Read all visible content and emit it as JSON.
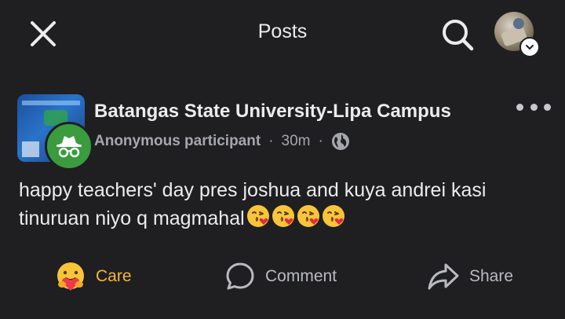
{
  "header": {
    "title": "Posts",
    "close_icon": "close-icon",
    "search_icon": "search-icon",
    "account_menu_icon": "chevron-down-icon"
  },
  "post": {
    "group_name": "Batangas State University-Lipa Campus",
    "author": "Anonymous participant",
    "time": "30m",
    "separator": "·",
    "audience_icon": "globe-icon",
    "more_icon": "more-horizontal-icon",
    "text": "happy teachers' day pres joshua and kuya andrei kasi tinuruan niyo q magmahal",
    "emoji_count": 4,
    "emoji_icon": "face-blowing-kiss-emoji"
  },
  "actions": {
    "care_label": "Care",
    "comment_label": "Comment",
    "share_label": "Share"
  },
  "colors": {
    "background": "#1f1f21",
    "care": "#f4b63c",
    "anonymous_badge": "#3a9b3f",
    "secondary_text": "#a5a7ad"
  }
}
